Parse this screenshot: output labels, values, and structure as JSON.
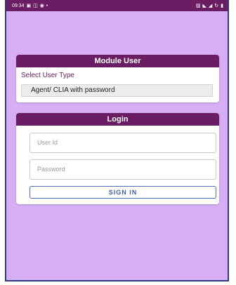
{
  "status_bar": {
    "time": "09:34",
    "left_icons": [
      "sim-icon",
      "message-icon",
      "record-icon",
      "dot-icon"
    ],
    "right_icons": [
      "alarm-icon",
      "signal-icon",
      "wifi-icon",
      "sync-icon",
      "battery-icon"
    ]
  },
  "module_card": {
    "title": "Module User",
    "select_label": "Select User Type",
    "selected_value": "Agent/ CLIA with password"
  },
  "login_card": {
    "title": "Login",
    "userid_placeholder": "User Id",
    "password_placeholder": "Password",
    "signin_label": "SIGN IN"
  },
  "colors": {
    "background": "#d7aef4",
    "header": "#6a1d62",
    "accent_text": "#6a1d62",
    "button_text": "#3b5fa7"
  }
}
